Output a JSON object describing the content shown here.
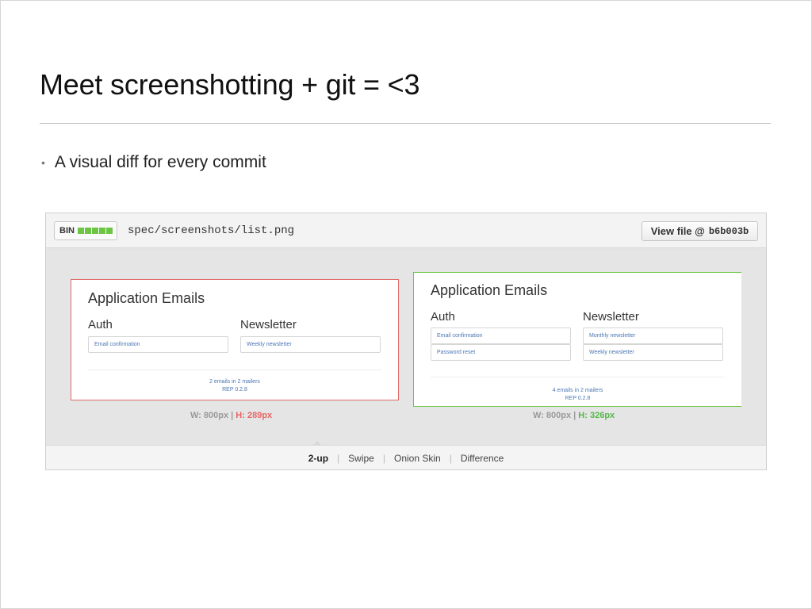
{
  "slide": {
    "title": "Meet screenshotting + git = <3",
    "bullet": "A visual diff for every commit"
  },
  "diff": {
    "bin_label": "BIN",
    "file_path": "spec/screenshots/list.png",
    "view_file_label": "View file @",
    "commit_sha": "b6b003b",
    "old": {
      "title": "Application Emails",
      "col1": "Auth",
      "col2": "Newsletter",
      "auth_fields": [
        "Email confirmation"
      ],
      "newsletter_fields": [
        "Weekly newsletter"
      ],
      "footer_line1": "2 emails in 2 mailers",
      "footer_line2": "REP 0.2.8",
      "width_label": "W: 800px",
      "height_label": "H: 289px"
    },
    "new": {
      "title": "Application Emails",
      "col1": "Auth",
      "col2": "Newsletter",
      "auth_fields": [
        "Email confirmation",
        "Password reset"
      ],
      "newsletter_fields": [
        "Monthly newsletter",
        "Weekly newsletter"
      ],
      "footer_line1": "4 emails in 2 mailers",
      "footer_line2": "REP 0.2.8",
      "width_label": "W: 800px",
      "height_label": "H: 326px"
    },
    "tabs": [
      "2-up",
      "Swipe",
      "Onion Skin",
      "Difference"
    ],
    "active_tab": "2-up",
    "colors": {
      "removed": "#e26a6a",
      "added": "#6cc644",
      "link": "#4a77b4"
    }
  }
}
